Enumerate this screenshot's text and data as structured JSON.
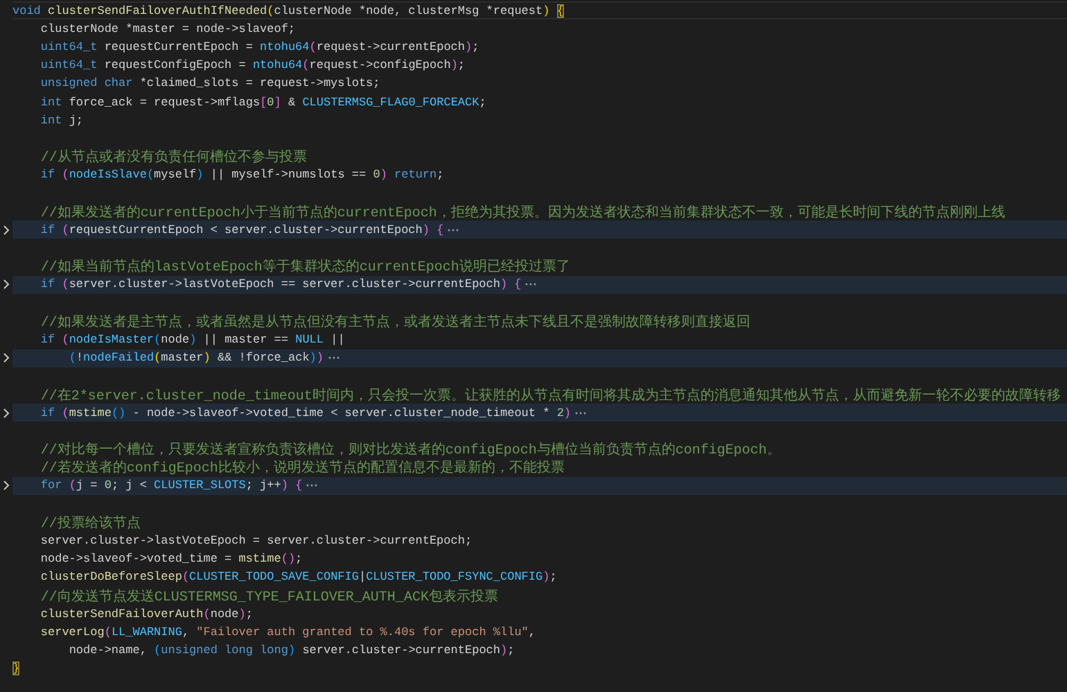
{
  "editor": {
    "lines": [
      {
        "folded": false,
        "current": true,
        "tokens": [
          {
            "kind": "kw",
            "text": "void "
          },
          {
            "kind": "fn",
            "text": "clusterSendFailoverAuthIfNeeded"
          },
          {
            "kind": "p1",
            "text": "("
          },
          {
            "kind": "plain",
            "text": "clusterNode *node, clusterMsg *request"
          },
          {
            "kind": "p1",
            "text": ") "
          },
          {
            "kind": "brace",
            "text": "{"
          }
        ]
      },
      {
        "folded": false,
        "current": false,
        "tokens": [
          {
            "kind": "plain",
            "text": "    clusterNode *master = node->slaveof;"
          }
        ]
      },
      {
        "folded": false,
        "current": false,
        "tokens": [
          {
            "kind": "kw",
            "text": "    uint64_t"
          },
          {
            "kind": "plain",
            "text": " requestCurrentEpoch = "
          },
          {
            "kind": "mac",
            "text": "ntohu64"
          },
          {
            "kind": "p2",
            "text": "("
          },
          {
            "kind": "plain",
            "text": "request->currentEpoch"
          },
          {
            "kind": "p2",
            "text": ")"
          },
          {
            "kind": "plain",
            "text": ";"
          }
        ]
      },
      {
        "folded": false,
        "current": false,
        "tokens": [
          {
            "kind": "kw",
            "text": "    uint64_t"
          },
          {
            "kind": "plain",
            "text": " requestConfigEpoch = "
          },
          {
            "kind": "mac",
            "text": "ntohu64"
          },
          {
            "kind": "p2",
            "text": "("
          },
          {
            "kind": "plain",
            "text": "request->configEpoch"
          },
          {
            "kind": "p2",
            "text": ")"
          },
          {
            "kind": "plain",
            "text": ";"
          }
        ]
      },
      {
        "folded": false,
        "current": false,
        "tokens": [
          {
            "kind": "kw",
            "text": "    unsigned char"
          },
          {
            "kind": "plain",
            "text": " *claimed_slots = request->myslots;"
          }
        ]
      },
      {
        "folded": false,
        "current": false,
        "tokens": [
          {
            "kind": "kw",
            "text": "    int"
          },
          {
            "kind": "plain",
            "text": " force_ack = request->mflags"
          },
          {
            "kind": "p2",
            "text": "["
          },
          {
            "kind": "num",
            "text": "0"
          },
          {
            "kind": "p2",
            "text": "]"
          },
          {
            "kind": "plain",
            "text": " & "
          },
          {
            "kind": "mac",
            "text": "CLUSTERMSG_FLAG0_FORCEACK"
          },
          {
            "kind": "plain",
            "text": ";"
          }
        ]
      },
      {
        "folded": false,
        "current": false,
        "tokens": [
          {
            "kind": "kw",
            "text": "    int"
          },
          {
            "kind": "plain",
            "text": " j;"
          }
        ]
      },
      {
        "folded": false,
        "current": false
      },
      {
        "folded": false,
        "current": false,
        "tokens": [
          {
            "kind": "cmt",
            "text": "    //从节点或者没有负责任何槽位不参与投票"
          }
        ]
      },
      {
        "folded": false,
        "current": false,
        "tokens": [
          {
            "kind": "kw",
            "text": "    if "
          },
          {
            "kind": "p2",
            "text": "("
          },
          {
            "kind": "mac",
            "text": "nodeIsSlave"
          },
          {
            "kind": "p3",
            "text": "("
          },
          {
            "kind": "plain",
            "text": "myself"
          },
          {
            "kind": "p3",
            "text": ")"
          },
          {
            "kind": "plain",
            "text": " || myself->numslots == "
          },
          {
            "kind": "num",
            "text": "0"
          },
          {
            "kind": "p2",
            "text": ") "
          },
          {
            "kind": "kw",
            "text": "return"
          },
          {
            "kind": "plain",
            "text": ";"
          }
        ]
      },
      {
        "folded": false,
        "current": false
      },
      {
        "folded": false,
        "current": false,
        "tokens": [
          {
            "kind": "cmt",
            "text": "    //如果发送者的currentEpoch小于当前节点的currentEpoch，拒绝为其投票。因为发送者状态和当前集群状态不一致，可能是长时间下线的节点刚刚上线"
          }
        ]
      },
      {
        "folded": true,
        "current": false,
        "tokens": [
          {
            "kind": "kw",
            "text": "    if "
          },
          {
            "kind": "p2",
            "text": "("
          },
          {
            "kind": "plain",
            "text": "requestCurrentEpoch < server.cluster->currentEpoch"
          },
          {
            "kind": "p2",
            "text": ") {"
          }
        ]
      },
      {
        "folded": false,
        "current": false
      },
      {
        "folded": false,
        "current": false,
        "tokens": [
          {
            "kind": "cmt",
            "text": "    //如果当前节点的lastVoteEpoch等于集群状态的currentEpoch说明已经投过票了"
          }
        ]
      },
      {
        "folded": true,
        "current": false,
        "tokens": [
          {
            "kind": "kw",
            "text": "    if "
          },
          {
            "kind": "p2",
            "text": "("
          },
          {
            "kind": "plain",
            "text": "server.cluster->lastVoteEpoch == server.cluster->currentEpoch"
          },
          {
            "kind": "p2",
            "text": ") {"
          }
        ]
      },
      {
        "folded": false,
        "current": false
      },
      {
        "folded": false,
        "current": false,
        "tokens": [
          {
            "kind": "cmt",
            "text": "    //如果发送者是主节点，或者虽然是从节点但没有主节点，或者发送者主节点未下线且不是强制故障转移则直接返回"
          }
        ]
      },
      {
        "folded": false,
        "current": false,
        "tokens": [
          {
            "kind": "kw",
            "text": "    if "
          },
          {
            "kind": "p2",
            "text": "("
          },
          {
            "kind": "mac",
            "text": "nodeIsMaster"
          },
          {
            "kind": "p3",
            "text": "("
          },
          {
            "kind": "plain",
            "text": "node"
          },
          {
            "kind": "p3",
            "text": ")"
          },
          {
            "kind": "plain",
            "text": " || master == "
          },
          {
            "kind": "mac",
            "text": "NULL"
          },
          {
            "kind": "plain",
            "text": " ||"
          }
        ]
      },
      {
        "folded": true,
        "current": false,
        "tokens": [
          {
            "kind": "p3",
            "text": "        ("
          },
          {
            "kind": "plain",
            "text": "!"
          },
          {
            "kind": "mac",
            "text": "nodeFailed"
          },
          {
            "kind": "p1",
            "text": "("
          },
          {
            "kind": "plain",
            "text": "master"
          },
          {
            "kind": "p1",
            "text": ")"
          },
          {
            "kind": "plain",
            "text": " && !force_ack"
          },
          {
            "kind": "p3",
            "text": ")"
          },
          {
            "kind": "p2",
            "text": ")"
          }
        ]
      },
      {
        "folded": false,
        "current": false
      },
      {
        "folded": false,
        "current": false,
        "tokens": [
          {
            "kind": "cmt",
            "text": "    //在2*server.cluster_node_timeout时间内，只会投一次票。让获胜的从节点有时间将其成为主节点的消息通知其他从节点，从而避免新一轮不必要的故障转移"
          }
        ]
      },
      {
        "folded": true,
        "current": false,
        "tokens": [
          {
            "kind": "kw",
            "text": "    if "
          },
          {
            "kind": "p2",
            "text": "("
          },
          {
            "kind": "fn",
            "text": "mstime"
          },
          {
            "kind": "p3",
            "text": "()"
          },
          {
            "kind": "plain",
            "text": " - node->slaveof->voted_time < server.cluster_node_timeout * "
          },
          {
            "kind": "num",
            "text": "2"
          },
          {
            "kind": "p2",
            "text": ")"
          }
        ]
      },
      {
        "folded": false,
        "current": false
      },
      {
        "folded": false,
        "current": false,
        "tokens": [
          {
            "kind": "cmt",
            "text": "    //对比每一个槽位，只要发送者宣称负责该槽位，则对比发送者的configEpoch与槽位当前负责节点的configEpoch。"
          }
        ]
      },
      {
        "folded": false,
        "current": false,
        "tokens": [
          {
            "kind": "cmt",
            "text": "    //若发送者的configEpoch比较小，说明发送节点的配置信息不是最新的，不能投票"
          }
        ]
      },
      {
        "folded": true,
        "current": false,
        "tokens": [
          {
            "kind": "kw",
            "text": "    for "
          },
          {
            "kind": "p2",
            "text": "("
          },
          {
            "kind": "plain",
            "text": "j = "
          },
          {
            "kind": "num",
            "text": "0"
          },
          {
            "kind": "plain",
            "text": "; j < "
          },
          {
            "kind": "mac",
            "text": "CLUSTER_SLOTS"
          },
          {
            "kind": "plain",
            "text": "; j++"
          },
          {
            "kind": "p2",
            "text": ") {"
          }
        ]
      },
      {
        "folded": false,
        "current": false
      },
      {
        "folded": false,
        "current": false,
        "tokens": [
          {
            "kind": "cmt",
            "text": "    //投票给该节点"
          }
        ]
      },
      {
        "folded": false,
        "current": false,
        "tokens": [
          {
            "kind": "plain",
            "text": "    server.cluster->lastVoteEpoch = server.cluster->currentEpoch;"
          }
        ]
      },
      {
        "folded": false,
        "current": false,
        "tokens": [
          {
            "kind": "plain",
            "text": "    node->slaveof->voted_time = "
          },
          {
            "kind": "fn",
            "text": "mstime"
          },
          {
            "kind": "p2",
            "text": "()"
          },
          {
            "kind": "plain",
            "text": ";"
          }
        ]
      },
      {
        "folded": false,
        "current": false,
        "tokens": [
          {
            "kind": "fn",
            "text": "    clusterDoBeforeSleep"
          },
          {
            "kind": "p2",
            "text": "("
          },
          {
            "kind": "mac",
            "text": "CLUSTER_TODO_SAVE_CONFIG"
          },
          {
            "kind": "plain",
            "text": "|"
          },
          {
            "kind": "mac",
            "text": "CLUSTER_TODO_FSYNC_CONFIG"
          },
          {
            "kind": "p2",
            "text": ")"
          },
          {
            "kind": "plain",
            "text": ";"
          }
        ]
      },
      {
        "folded": false,
        "current": false,
        "tokens": [
          {
            "kind": "cmt",
            "text": "    //向发送节点发送CLUSTERMSG_TYPE_FAILOVER_AUTH_ACK包表示投票"
          }
        ]
      },
      {
        "folded": false,
        "current": false,
        "tokens": [
          {
            "kind": "fn",
            "text": "    clusterSendFailoverAuth"
          },
          {
            "kind": "p2",
            "text": "("
          },
          {
            "kind": "plain",
            "text": "node"
          },
          {
            "kind": "p2",
            "text": ")"
          },
          {
            "kind": "plain",
            "text": ";"
          }
        ]
      },
      {
        "folded": false,
        "current": false,
        "tokens": [
          {
            "kind": "fn",
            "text": "    serverLog"
          },
          {
            "kind": "p2",
            "text": "("
          },
          {
            "kind": "mac",
            "text": "LL_WARNING"
          },
          {
            "kind": "plain",
            "text": ", "
          },
          {
            "kind": "str",
            "text": "\"Failover auth granted to %.40s for epoch %llu\""
          },
          {
            "kind": "plain",
            "text": ","
          }
        ]
      },
      {
        "folded": false,
        "current": false,
        "tokens": [
          {
            "kind": "plain",
            "text": "        node->name, "
          },
          {
            "kind": "p3",
            "text": "("
          },
          {
            "kind": "kw",
            "text": "unsigned long long"
          },
          {
            "kind": "p3",
            "text": ")"
          },
          {
            "kind": "plain",
            "text": " server.cluster->currentEpoch"
          },
          {
            "kind": "p2",
            "text": ")"
          },
          {
            "kind": "plain",
            "text": ";"
          }
        ]
      },
      {
        "folded": false,
        "current": false,
        "tokens": [
          {
            "kind": "brace",
            "text": "}"
          }
        ]
      }
    ]
  }
}
